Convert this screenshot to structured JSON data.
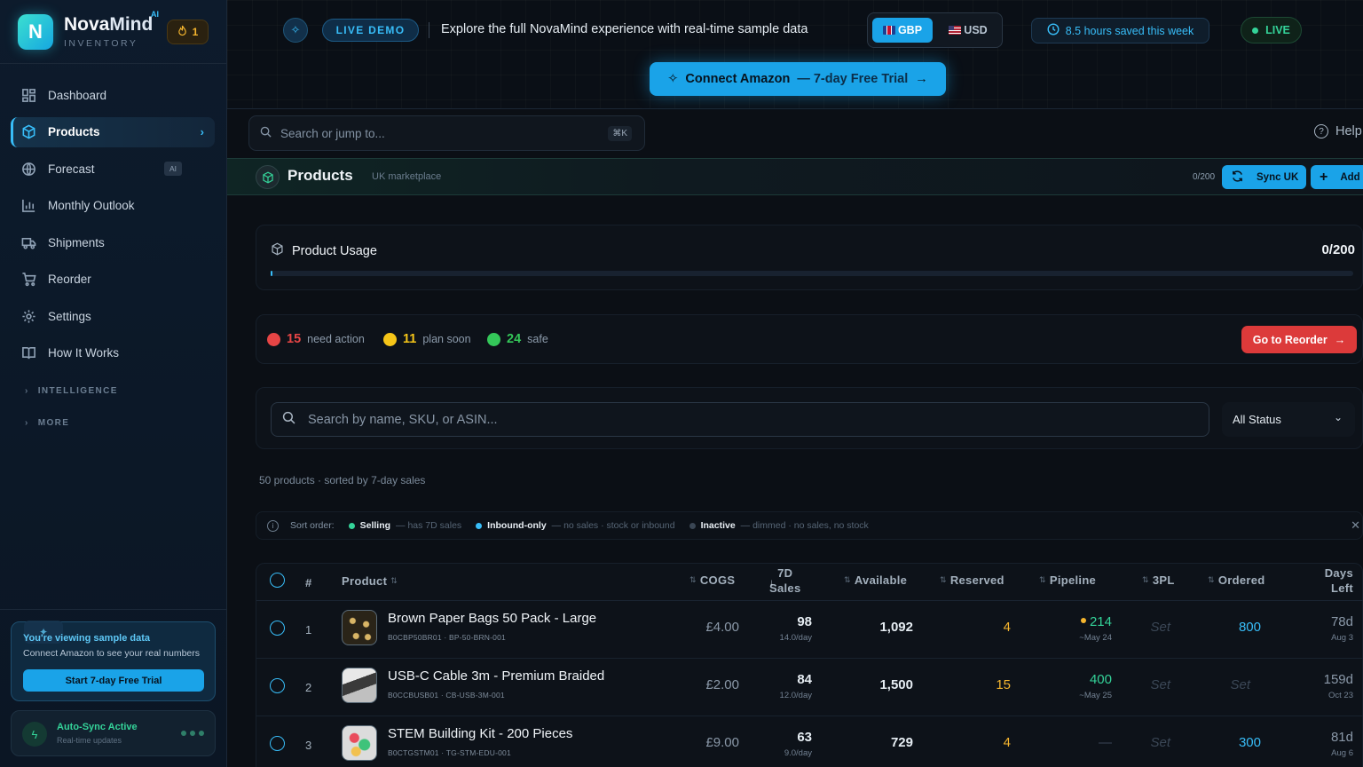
{
  "brand": {
    "name_a": "Nova",
    "name_b": "Mind",
    "ai_tag": "AI",
    "subtitle": "INVENTORY",
    "streak": "1"
  },
  "sidebar": {
    "items": [
      {
        "label": "Dashboard",
        "icon": "grid-icon"
      },
      {
        "label": "Products",
        "icon": "box-icon",
        "active": true
      },
      {
        "label": "Forecast",
        "icon": "globe-icon",
        "badge": "AI"
      },
      {
        "label": "Monthly Outlook",
        "icon": "bar-chart-icon"
      },
      {
        "label": "Shipments",
        "icon": "truck-icon"
      },
      {
        "label": "Reorder",
        "icon": "cart-icon"
      },
      {
        "label": "Settings",
        "icon": "gear-icon"
      },
      {
        "label": "How It Works",
        "icon": "book-icon"
      }
    ],
    "sections": [
      "INTELLIGENCE",
      "MORE"
    ],
    "sample_card": {
      "title": "You're viewing sample data",
      "subtitle": "Connect Amazon to see your real numbers",
      "button": "Start 7-day Free Trial"
    },
    "sync_card": {
      "title": "Auto-Sync Active",
      "subtitle": "Real-time updates"
    }
  },
  "topbar": {
    "live_demo": "LIVE DEMO",
    "explore": "Explore the full NovaMind experience with real-time sample data",
    "currency_selected": "GBP",
    "currency_other": "USD",
    "hours_saved": "8.5 hours saved this week",
    "live": "LIVE",
    "connect_label": "Connect Amazon",
    "connect_trial": "— 7-day Free Trial"
  },
  "search": {
    "placeholder": "Search or jump to...",
    "shortcut": "⌘K",
    "help": "Help"
  },
  "page_header": {
    "title": "Products",
    "subtitle": "UK marketplace",
    "count": "0/200",
    "sync_label": "Sync UK",
    "add_label": "Add"
  },
  "usage": {
    "title": "Product Usage",
    "value": "0/200",
    "fraction": 0.002
  },
  "status_summary": {
    "need_action": {
      "count": "15",
      "label": "need action",
      "color": "#e64545"
    },
    "plan_soon": {
      "count": "11",
      "label": "plan soon",
      "color": "#f5c518"
    },
    "safe": {
      "count": "24",
      "label": "safe",
      "color": "#34c759"
    },
    "reorder_button": "Go to Reorder"
  },
  "filters": {
    "search_placeholder": "Search by name, SKU, or ASIN...",
    "status_value": "All Status"
  },
  "count_line": "50 products · sorted by 7-day sales",
  "sort_legend": {
    "label": "Sort order:",
    "items": [
      {
        "name": "Selling",
        "desc": "— has 7D sales",
        "color": "#34d399"
      },
      {
        "name": "Inbound-only",
        "desc": "— no sales · stock or inbound",
        "color": "#38bdf8"
      },
      {
        "name": "Inactive",
        "desc": "— dimmed · no sales, no stock",
        "color": "#3a4654"
      }
    ]
  },
  "table": {
    "headers": {
      "num": "#",
      "product": "Product",
      "cogs": "COGS",
      "sales_a": "7D",
      "sales_b": "Sales",
      "available": "Available",
      "reserved": "Reserved",
      "pipeline": "Pipeline",
      "tpl": "3PL",
      "ordered": "Ordered",
      "days_a": "Days",
      "days_b": "Left"
    },
    "rows": [
      {
        "num": "1",
        "name": "Brown Paper Bags 50 Pack - Large",
        "sku": "B0CBP50BR01 · BP-50-BRN-001",
        "cogs": "£4.00",
        "sales": "98",
        "rate": "14.0/day",
        "available": "1,092",
        "reserved": "4",
        "pipeline": "214",
        "pipeline_date": "~May 24",
        "tpl": "Set",
        "ordered": "800",
        "days": "78d",
        "days_date": "Aug 3"
      },
      {
        "num": "2",
        "name": "USB-C Cable 3m - Premium Braided",
        "sku": "B0CCBUSB01 · CB-USB-3M-001",
        "cogs": "£2.00",
        "sales": "84",
        "rate": "12.0/day",
        "available": "1,500",
        "reserved": "15",
        "pipeline": "400",
        "pipeline_date": "~May 25",
        "tpl": "Set",
        "ordered": "Set",
        "days": "159d",
        "days_date": "Oct 23"
      },
      {
        "num": "3",
        "name": "STEM Building Kit - 200 Pieces",
        "sku": "B0CTGSTM01 · TG-STM-EDU-001",
        "cogs": "£9.00",
        "sales": "63",
        "rate": "9.0/day",
        "available": "729",
        "reserved": "4",
        "pipeline": "—",
        "pipeline_date": "",
        "tpl": "Set",
        "ordered": "300",
        "days": "81d",
        "days_date": "Aug 6"
      }
    ]
  }
}
